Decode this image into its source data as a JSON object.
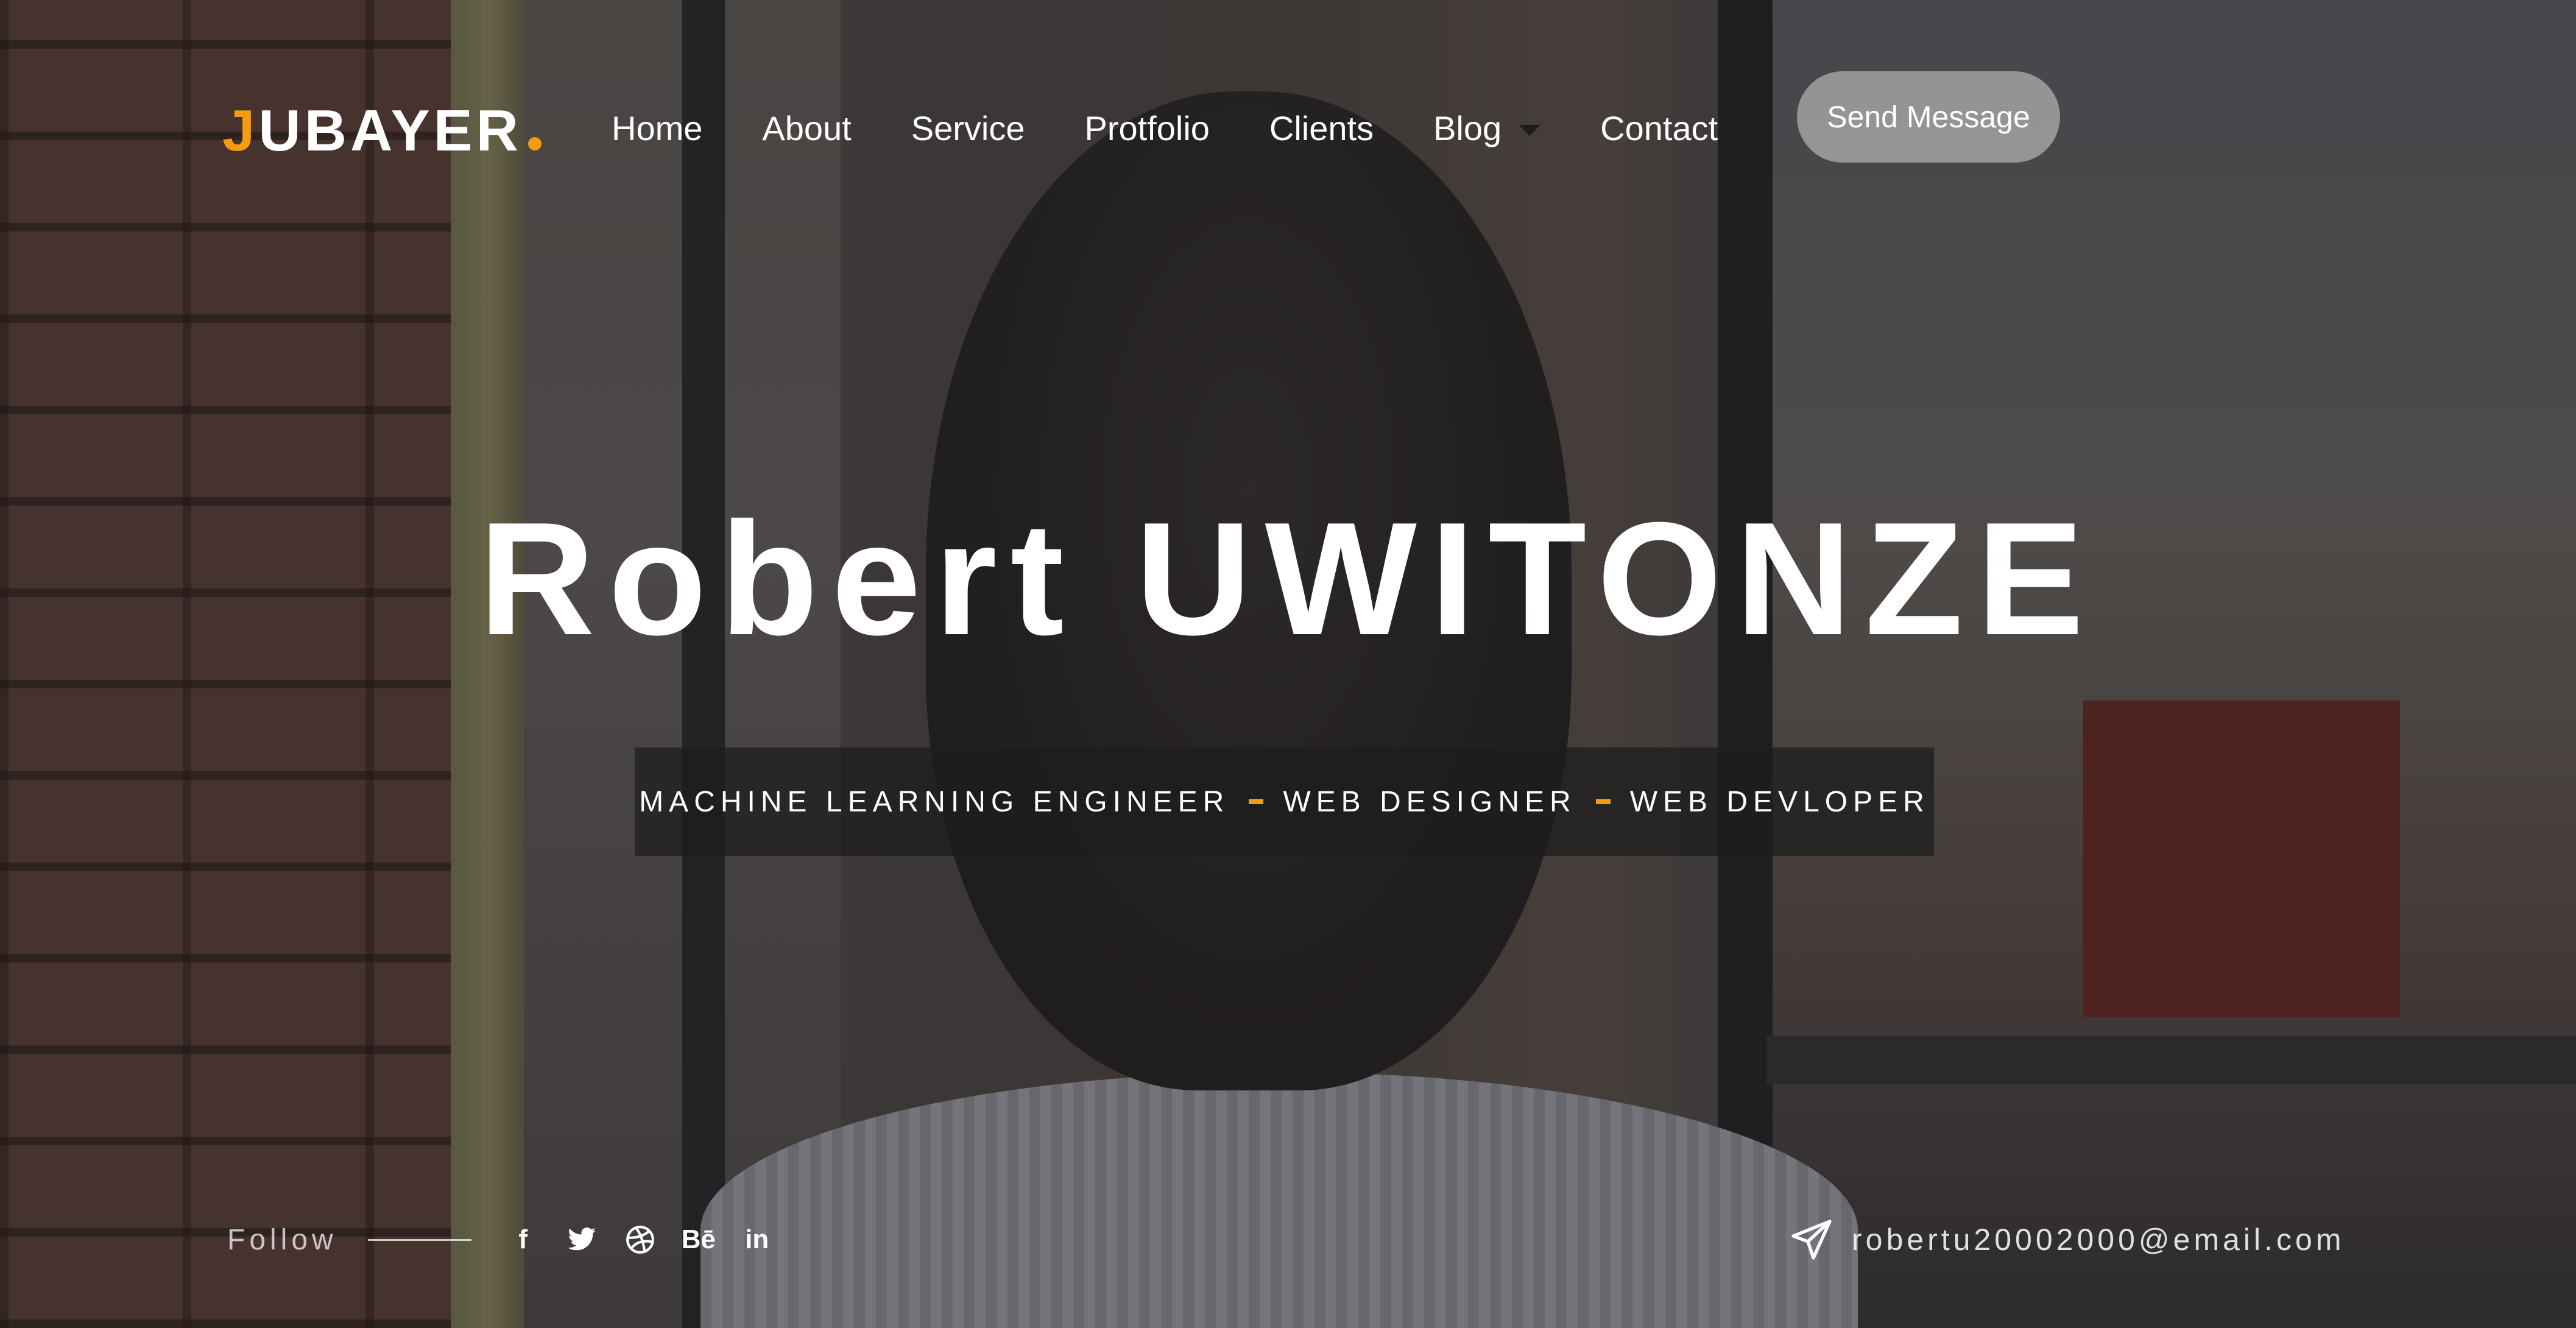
{
  "header": {
    "logo": {
      "first_letter": "J",
      "rest": "UBAYER"
    },
    "nav": [
      {
        "label": "Home"
      },
      {
        "label": "About"
      },
      {
        "label": "Service"
      },
      {
        "label": "Protfolio"
      },
      {
        "label": "Clients"
      },
      {
        "label": "Blog",
        "has_dropdown": true
      },
      {
        "label": "Contact"
      }
    ],
    "cta_label": "Send Message"
  },
  "hero": {
    "name": "Robert UWITONZE",
    "roles": [
      "MACHINE LEARNING ENGINEER",
      "WEB DESIGNER",
      "WEB DEVLOPER"
    ]
  },
  "footer": {
    "follow_label": "Follow",
    "social": [
      {
        "icon": "facebook-icon",
        "glyph": "f"
      },
      {
        "icon": "twitter-icon"
      },
      {
        "icon": "dribbble-icon"
      },
      {
        "icon": "behance-icon",
        "glyph": "Bē"
      },
      {
        "icon": "linkedin-icon",
        "glyph": "in"
      }
    ],
    "email": "robertu20002000@email.com"
  },
  "colors": {
    "accent": "#f39c12",
    "text": "#ffffff",
    "cta_bg": "#aaaaaa",
    "role_box_bg": "#1e1e1e"
  }
}
